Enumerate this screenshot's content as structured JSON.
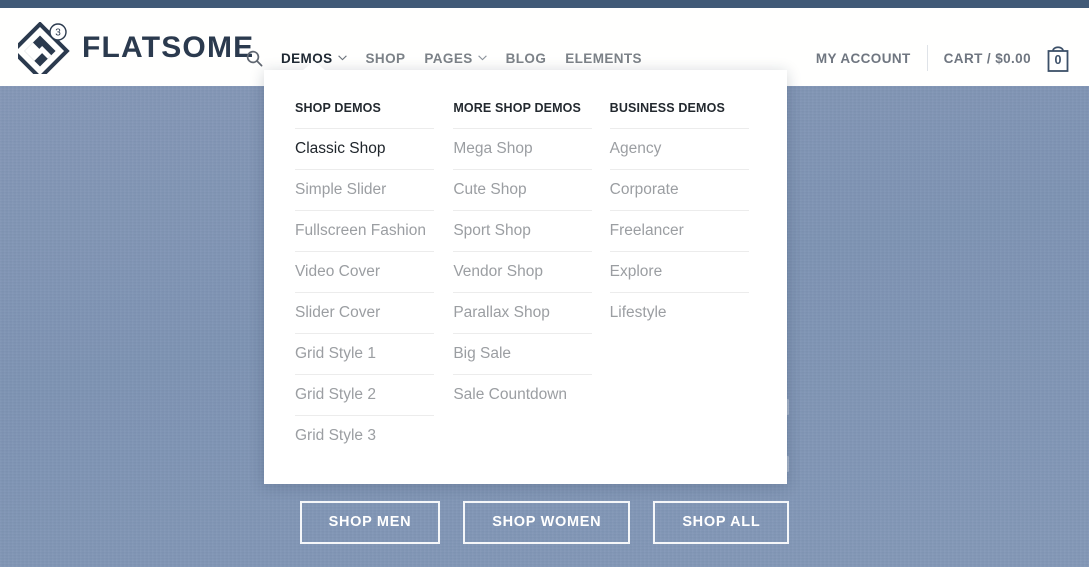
{
  "theme": {
    "topbar_color": "#415a77",
    "hero_color": "#8096b5",
    "accent_dark": "#2b3a4e",
    "nav_muted": "#7c8288",
    "nav_active": "#1f2933",
    "dropdown_bg": "#ffffff",
    "dropdown_item_color": "#9b9ea2",
    "dropdown_item_active_color": "#20262c"
  },
  "header": {
    "logo": {
      "name": "flatsome-logo",
      "text": "FLATSOME",
      "badge": "3",
      "mark_icon": "diamond-f-icon"
    },
    "search": {
      "icon": "search-icon",
      "label": "Search"
    },
    "nav": [
      {
        "label": "DEMOS",
        "has_chevron": true,
        "active": true
      },
      {
        "label": "SHOP",
        "has_chevron": false,
        "active": false
      },
      {
        "label": "PAGES",
        "has_chevron": true,
        "active": false
      },
      {
        "label": "BLOG",
        "has_chevron": false,
        "active": false
      },
      {
        "label": "ELEMENTS",
        "has_chevron": false,
        "active": false
      }
    ],
    "account_label": "MY ACCOUNT",
    "cart_label": "CART / $0.00",
    "cart_count": "0",
    "cart_icon": "shopping-bag-icon"
  },
  "dropdown": {
    "columns": [
      {
        "heading": "SHOP DEMOS",
        "items": [
          {
            "label": "Classic Shop",
            "highlighted": true
          },
          {
            "label": "Simple Slider",
            "highlighted": false
          },
          {
            "label": "Fullscreen Fashion",
            "highlighted": false
          },
          {
            "label": "Video Cover",
            "highlighted": false
          },
          {
            "label": "Slider Cover",
            "highlighted": false
          },
          {
            "label": "Grid Style 1",
            "highlighted": false
          },
          {
            "label": "Grid Style 2",
            "highlighted": false
          },
          {
            "label": "Grid Style 3",
            "highlighted": false
          }
        ]
      },
      {
        "heading": "MORE SHOP DEMOS",
        "items": [
          {
            "label": "Mega Shop",
            "highlighted": false
          },
          {
            "label": "Cute Shop",
            "highlighted": false
          },
          {
            "label": "Sport Shop",
            "highlighted": false
          },
          {
            "label": "Vendor Shop",
            "highlighted": false
          },
          {
            "label": "Parallax Shop",
            "highlighted": false
          },
          {
            "label": "Big Sale",
            "highlighted": false
          },
          {
            "label": "Sale Countdown",
            "highlighted": false
          }
        ]
      },
      {
        "heading": "BUSINESS DEMOS",
        "items": [
          {
            "label": "Agency",
            "highlighted": false
          },
          {
            "label": "Corporate",
            "highlighted": false
          },
          {
            "label": "Freelancer",
            "highlighted": false
          },
          {
            "label": "Explore",
            "highlighted": false
          },
          {
            "label": "Lifestyle",
            "highlighted": false
          }
        ]
      }
    ]
  },
  "hero": {
    "buttons": [
      {
        "label": "SHOP MEN"
      },
      {
        "label": "SHOP WOMEN"
      },
      {
        "label": "SHOP ALL"
      }
    ]
  }
}
